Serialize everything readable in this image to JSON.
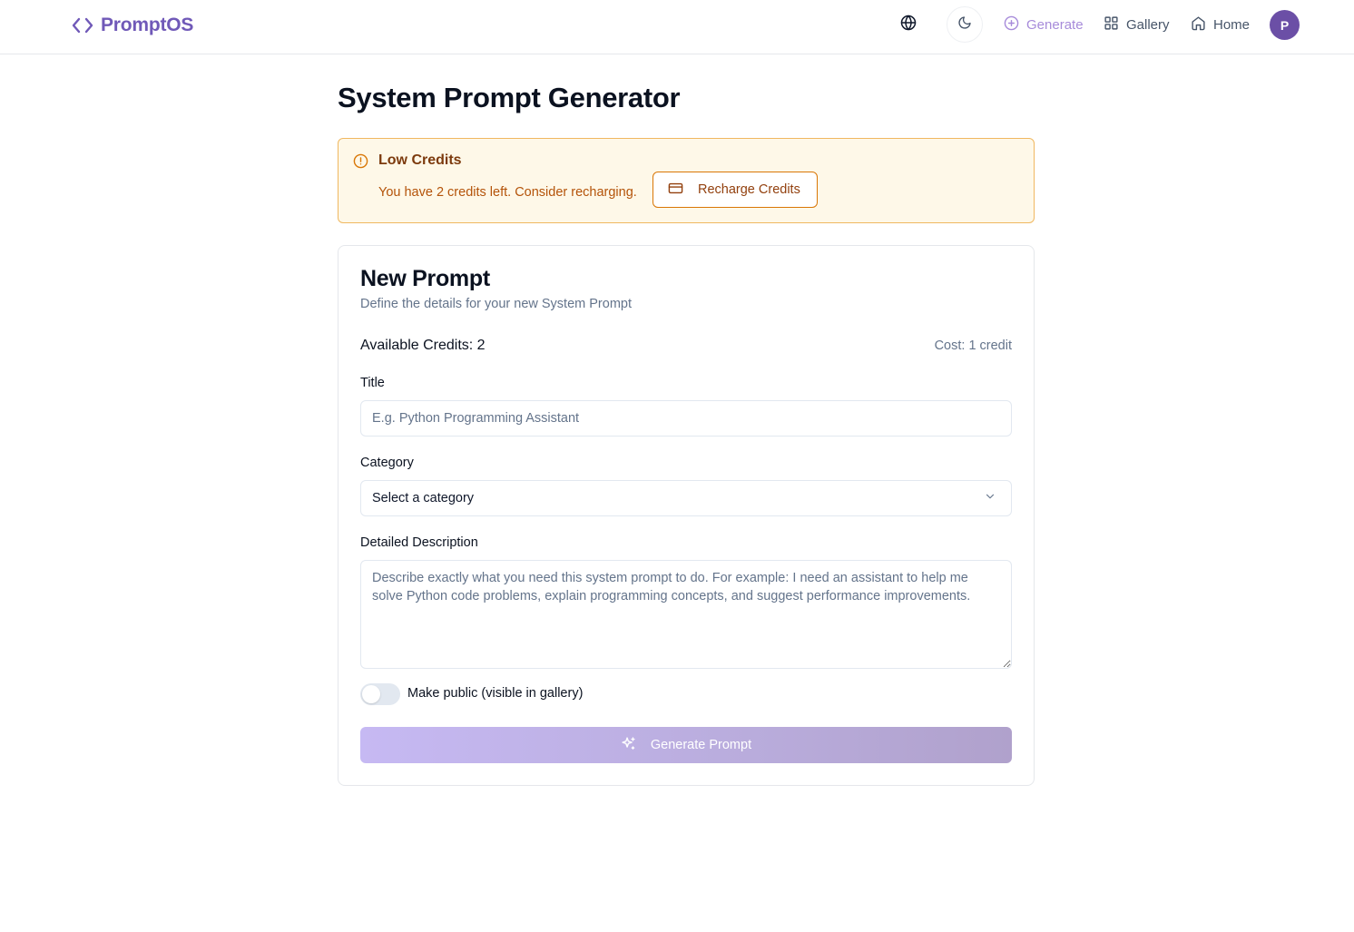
{
  "header": {
    "brand": "PromptOS",
    "nav": {
      "generate": "Generate",
      "gallery": "Gallery",
      "home": "Home"
    },
    "avatar_initial": "P",
    "accent_color": "#7059b8"
  },
  "page": {
    "title": "System Prompt Generator"
  },
  "alert": {
    "title": "Low Credits",
    "message": "You have 2 credits left. Consider recharging.",
    "button": "Recharge Credits"
  },
  "form": {
    "title": "New Prompt",
    "subtitle": "Define the details for your new System Prompt",
    "available_credits": "Available Credits: 2",
    "cost": "Cost: 1 credit",
    "title_label": "Title",
    "title_placeholder": "E.g. Python Programming Assistant",
    "category_label": "Category",
    "category_value": "Select a category",
    "description_label": "Detailed Description",
    "description_placeholder": "Describe exactly what you need this system prompt to do. For example: I need an assistant to help me solve Python code problems, explain programming concepts, and suggest performance improvements.",
    "public_toggle_label": "Make public (visible in gallery)",
    "public_toggle_on": false,
    "submit": "Generate Prompt"
  }
}
